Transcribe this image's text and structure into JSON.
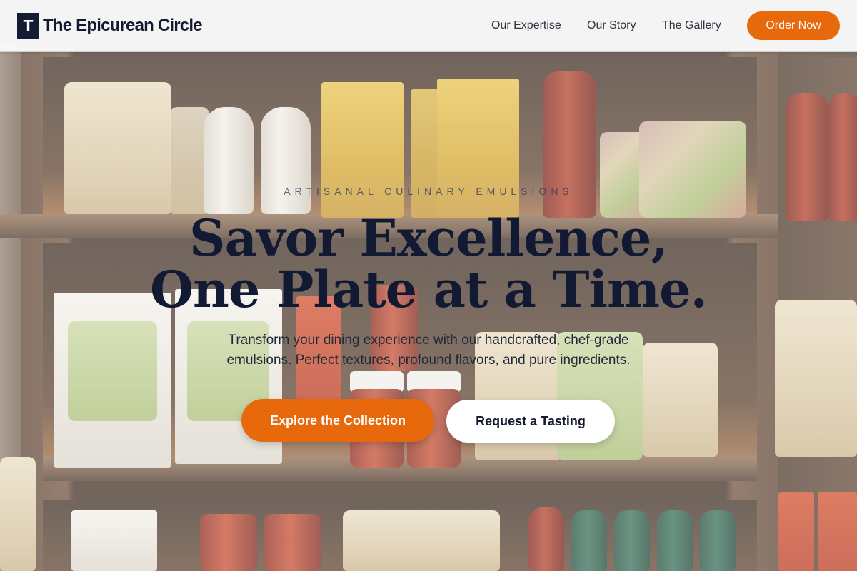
{
  "header": {
    "logo_letter": "T",
    "brand": "The Epicurean Circle",
    "nav": [
      "Our Expertise",
      "Our Story",
      "The Gallery"
    ],
    "cta": "Order Now"
  },
  "hero": {
    "eyebrow": "ARTISANAL CULINARY EMULSIONS",
    "title_line1": "Savor Excellence,",
    "title_line2": "One Plate at a Time.",
    "subtitle_line1": "Transform your dining experience with our handcrafted, chef-grade",
    "subtitle_line2": "emulsions. Perfect textures, profound flavors, and pure ingredients.",
    "primary_button": "Explore the Collection",
    "secondary_button": "Request a Tasting"
  },
  "colors": {
    "accent": "#e8680c",
    "navy": "#131c33",
    "header_bg": "#fafafa"
  }
}
